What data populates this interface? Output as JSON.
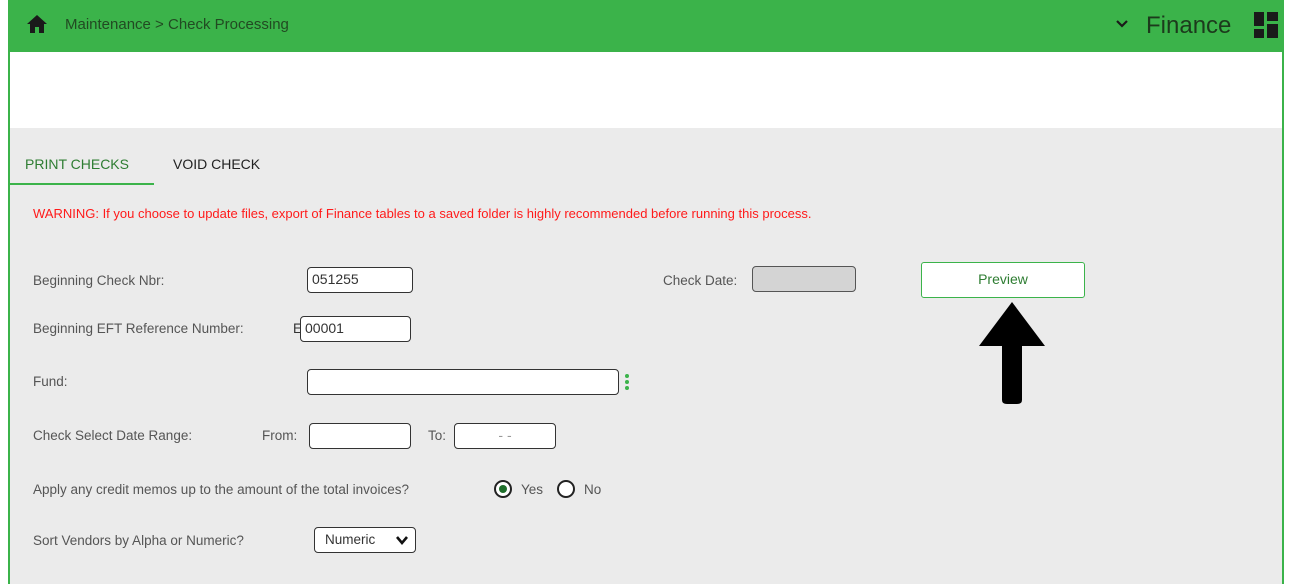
{
  "header": {
    "breadcrumb": "Maintenance > Check Processing",
    "app_name": "Finance",
    "icons": [
      "home-icon",
      "chevron-down-icon",
      "apps-grid-icon"
    ],
    "accent_color": "#3bb34a"
  },
  "tabs": [
    {
      "label": "PRINT CHECKS",
      "active": true
    },
    {
      "label": "VOID CHECK",
      "active": false
    }
  ],
  "warning": "WARNING: If you choose to update files, export of Finance tables to a saved folder is highly recommended before running this process.",
  "form": {
    "beginning_check_nbr": {
      "label": "Beginning Check Nbr:",
      "value": "051255"
    },
    "eft_reference": {
      "label": "Beginning EFT Reference Number:",
      "prefix": "E",
      "value": "00001"
    },
    "fund": {
      "label": "Fund:",
      "value": ""
    },
    "date_range": {
      "label": "Check Select Date Range:",
      "from_label": "From:",
      "from_value": "",
      "to_label": "To:",
      "to_value": "- -"
    },
    "credit_memos": {
      "label": "Apply any credit memos up to the amount of the total invoices?",
      "yes_label": "Yes",
      "no_label": "No",
      "selected": "Yes"
    },
    "sort_vendors": {
      "label": "Sort Vendors by Alpha or Numeric?",
      "selected": "Numeric"
    },
    "check_date": {
      "label": "Check Date:",
      "value": ""
    }
  },
  "actions": {
    "preview_label": "Preview"
  }
}
